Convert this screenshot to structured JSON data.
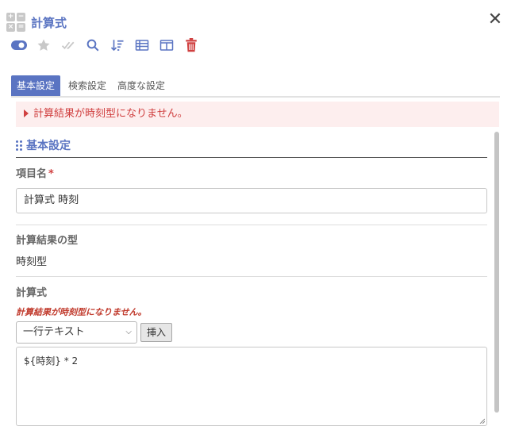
{
  "header": {
    "title": "計算式",
    "close_icon": "close-icon",
    "app_icon": "calculator-icon"
  },
  "toolbar": {
    "icons": [
      "toggle-on-icon",
      "star-icon",
      "double-check-icon",
      "search-icon",
      "sort-desc-icon",
      "table-list-icon",
      "columns-icon",
      "trash-icon"
    ],
    "accent": "#5a74c2",
    "danger": "#d04040"
  },
  "tabs": [
    {
      "label": "基本設定",
      "active": true
    },
    {
      "label": "検索設定",
      "active": false
    },
    {
      "label": "高度な設定",
      "active": false
    }
  ],
  "alert": {
    "message": "計算結果が時刻型になりません。"
  },
  "section": {
    "title": "基本設定"
  },
  "fields": {
    "item_name": {
      "label": "項目名",
      "required_mark": "*",
      "value": "計算式 時刻"
    },
    "result_type": {
      "label": "計算結果の型",
      "value": "時刻型"
    },
    "formula": {
      "label": "計算式",
      "error": "計算結果が時刻型になりません。",
      "select_value": "一行テキスト",
      "insert_label": "挿入",
      "expression": "${時刻} * 2"
    }
  }
}
